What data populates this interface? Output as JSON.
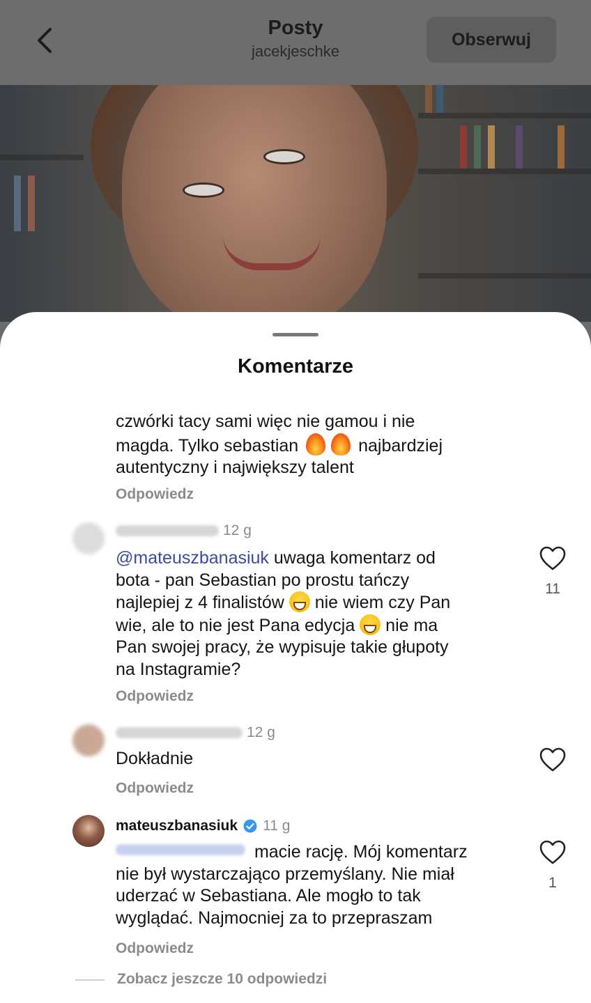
{
  "header": {
    "title": "Posty",
    "subtitle": "jacekjeschke",
    "follow_label": "Obserwuj"
  },
  "sheet": {
    "title": "Komentarze"
  },
  "comments": [
    {
      "text_line1": "czwórki tacy sami więc nie gamou i nie",
      "text_line2a": "magda. Tylko sebastian",
      "text_line2b": "najbardziej",
      "text_line3": "autentyczny i największy talent",
      "reply_label": "Odpowiedz"
    },
    {
      "time": "12 g",
      "mention": "@mateuszbanasiuk",
      "text_a": " uwaga komentarz od",
      "text_b": "bota - pan Sebastian po prostu tańczy",
      "text_c": "najlepiej z 4 finalistów",
      "text_d": " nie wiem czy Pan",
      "text_e": "wie, ale to nie jest Pana edycja",
      "text_f": " nie ma",
      "text_g": "Pan swojej pracy, że wypisuje takie głupoty",
      "text_h": "na Instagramie?",
      "likes": "11",
      "reply_label": "Odpowiedz"
    },
    {
      "time": "12 g",
      "text": "Dokładnie",
      "reply_label": "Odpowiedz"
    },
    {
      "username": "mateuszbanasiuk",
      "time": "11 g",
      "text_a": " macie rację. Mój komentarz",
      "text_b": "nie był wystarczająco przemyślany. Nie miał",
      "text_c": "uderzać w Sebastiana. Ale mogło to tak",
      "text_d": "wyglądać. Najmocniej za to przepraszam",
      "likes": "1",
      "reply_label": "Odpowiedz"
    }
  ],
  "view_more": "Zobacz jeszcze 10 odpowiedzi",
  "icons": {
    "back": "chevron-left-icon",
    "heart": "heart-outline-icon",
    "verified": "verified-badge-icon",
    "fire": "fire-emoji",
    "grin": "grinning-emoji"
  },
  "colors": {
    "mention": "#3b4aa5",
    "verified": "#3897f0",
    "muted": "#8b8b8b"
  }
}
